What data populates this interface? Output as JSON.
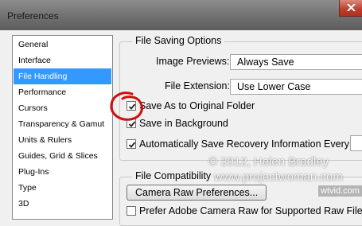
{
  "window": {
    "title": "Preferences"
  },
  "sidebar": {
    "items": [
      {
        "label": "General"
      },
      {
        "label": "Interface"
      },
      {
        "label": "File Handling",
        "selected": true
      },
      {
        "label": "Performance"
      },
      {
        "label": "Cursors"
      },
      {
        "label": "Transparency & Gamut"
      },
      {
        "label": "Units & Rulers"
      },
      {
        "label": "Guides, Grid & Slices"
      },
      {
        "label": "Plug-Ins"
      },
      {
        "label": "Type"
      },
      {
        "label": "3D"
      }
    ]
  },
  "file_saving": {
    "legend": "File Saving Options",
    "image_previews_label": "Image Previews:",
    "image_previews_value": "Always Save",
    "file_extension_label": "File Extension:",
    "file_extension_value": "Use Lower Case",
    "save_original_folder": {
      "label": "Save As to Original Folder",
      "checked": true
    },
    "save_background": {
      "label": "Save in Background",
      "checked": true
    },
    "auto_save_recovery": {
      "label": "Automatically Save Recovery Information Every:",
      "checked": true
    }
  },
  "file_compat": {
    "legend": "File Compatibility",
    "camera_raw_button": "Camera Raw Preferences...",
    "prefer_acr_label": "Prefer Adobe Camera Raw for Supported Raw Files"
  },
  "watermark": {
    "copyright": "© 2012, Helen Bradley",
    "site": "www.projectwoman.com",
    "logo": "wtvid.com"
  },
  "annotation_color": "#d01010"
}
